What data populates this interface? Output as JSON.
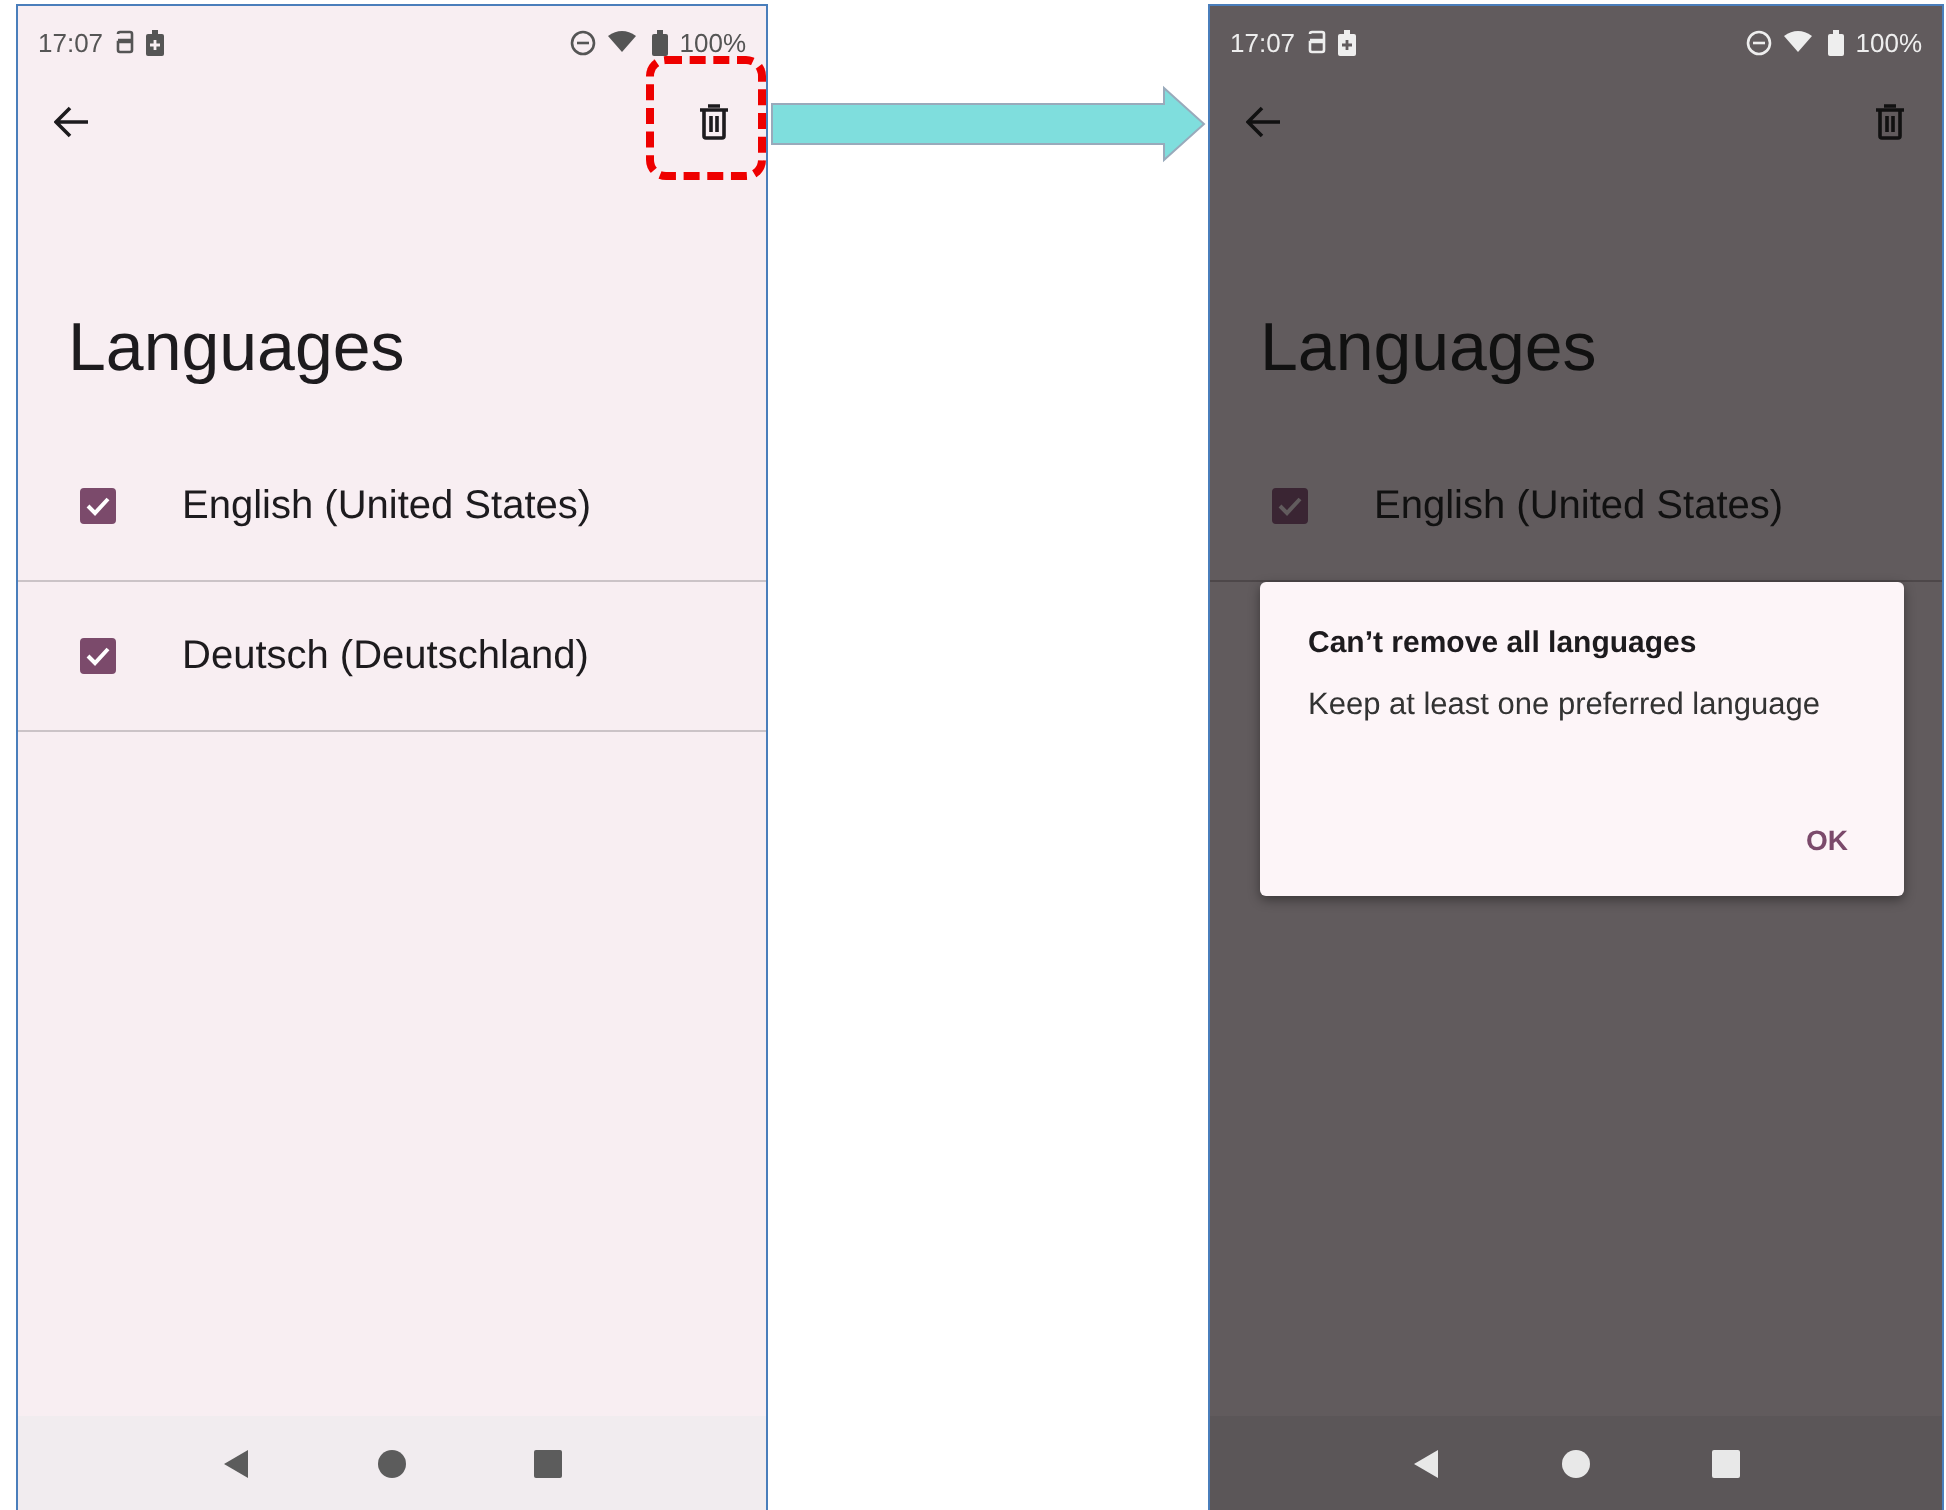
{
  "screens": [
    {
      "dimmed": false,
      "highlight_delete": true,
      "status_bar": {
        "time": "17:07",
        "battery": "100%"
      },
      "title": "Languages",
      "languages": [
        {
          "name": "English (United States)",
          "checked": true
        },
        {
          "name": "Deutsch (Deutschland)",
          "checked": true
        }
      ]
    },
    {
      "dimmed": true,
      "highlight_delete": false,
      "status_bar": {
        "time": "17:07",
        "battery": "100%"
      },
      "title": "Languages",
      "languages": [
        {
          "name": "English (United States)",
          "checked": true
        }
      ],
      "dialog": {
        "title": "Can’t remove all languages",
        "message": "Keep at least one preferred language",
        "button": "OK"
      }
    }
  ]
}
